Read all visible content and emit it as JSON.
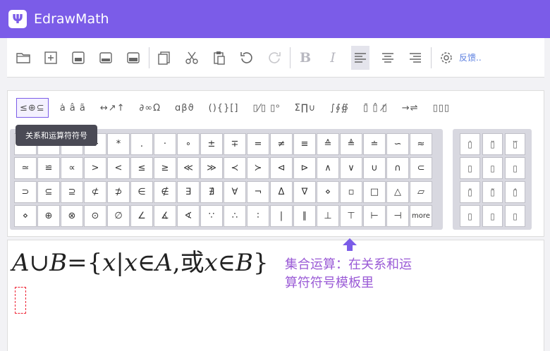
{
  "app": {
    "title": "EdrawMath",
    "logo_glyph": "Ψ",
    "accent_color": "#7b5ce8"
  },
  "toolbar": {
    "items": [
      "open-file-icon",
      "new-file-icon",
      "save-icon",
      "save-as-icon",
      "export-icon",
      "copy-icon",
      "cut-icon",
      "paste-icon",
      "undo-icon",
      "redo-icon"
    ],
    "bold_label": "B",
    "italic_label": "I",
    "feedback_label": "反馈.."
  },
  "palette": {
    "tabs": [
      "≤⊕⊆",
      "ȧ â ã",
      "↔↗↑",
      "∂∞Ω",
      "ɑβϑ",
      "(){}[]",
      "▯⁄▯ ▯ᵒ",
      "Σ∏∪",
      "∫∮∯",
      "▯̄ ▯̂ ▯̸",
      "→⇌",
      "▯▯▯"
    ],
    "tooltip": "关系和运算符符号",
    "symbols": [
      [
        "",
        "",
        "",
        "÷",
        "*",
        ".",
        "·",
        "∘",
        "±",
        "∓",
        "=",
        "≠",
        "≡",
        "≙",
        "≜",
        "≐",
        "∽",
        "≈"
      ],
      [
        "≃",
        "≌",
        "∝",
        ">",
        "<",
        "≤",
        "≥",
        "≪",
        "≫",
        "≺",
        "≻",
        "⊲",
        "⊳",
        "∧",
        "∨",
        "∪",
        "∩",
        "⊂"
      ],
      [
        "⊃",
        "⊆",
        "⊇",
        "⊄",
        "⊅",
        "∈",
        "∉",
        "∃",
        "∄",
        "∀",
        "¬",
        "Δ",
        "∇",
        "⋄",
        "▫",
        "□",
        "△",
        "▱"
      ],
      [
        "⋄",
        "⊕",
        "⊗",
        "⊙",
        "∅",
        "∠",
        "∡",
        "∢",
        "∵",
        "∴",
        "∶",
        "|",
        "∥",
        "⊥",
        "⊤",
        "⊢",
        "⊣",
        "more"
      ]
    ],
    "templates": [
      [
        "▯̇",
        "▯̈",
        "▯⃛"
      ],
      [
        "▯",
        "▯",
        "▯"
      ],
      [
        "▯̄",
        "▯̃",
        "▯̂"
      ],
      [
        "▯",
        "▯",
        "▯"
      ]
    ]
  },
  "editor": {
    "formula": {
      "A": "A",
      "cup": "∪",
      "B": "B",
      "eq": "=",
      "lb": "{",
      "x1": "x",
      "bar": "|",
      "x2": "x",
      "in1": "∈",
      "A2": "A",
      "comma": ",",
      "or": "或",
      "x3": "x",
      "in2": "∈",
      "B2": "B",
      "rb": "}"
    }
  },
  "annotation": {
    "line1": "集合运算：在关系和运",
    "line2": "算符符号模板里"
  }
}
